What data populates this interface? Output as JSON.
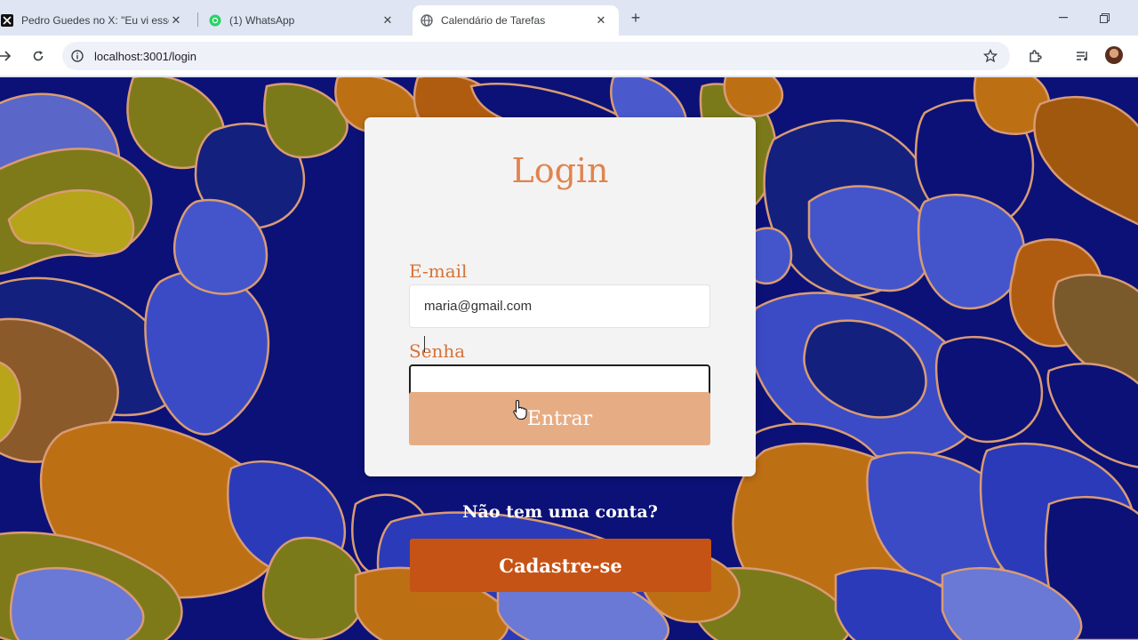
{
  "browser": {
    "tabs": [
      {
        "title": "Pedro Guedes no X: \"Eu vi esse",
        "icon": "x-logo-icon",
        "active": false
      },
      {
        "title": "(1) WhatsApp",
        "icon": "whatsapp-icon",
        "active": false
      },
      {
        "title": "Calendário de Tarefas",
        "icon": "globe-icon",
        "active": true
      }
    ],
    "url": "localhost:3001/login"
  },
  "login": {
    "title": "Login",
    "email_label": "E-mail",
    "email_value": "maria@gmail.com",
    "password_label": "Senha",
    "password_value": "",
    "submit_label": "Entrar"
  },
  "signup": {
    "prompt": "Não tem uma conta?",
    "button_label": "Cadastre-se"
  },
  "colors": {
    "accent": "#e0844e",
    "submit_button": "#e6ad85",
    "signup_button": "#c65316",
    "background_navy": "#0b1177"
  }
}
